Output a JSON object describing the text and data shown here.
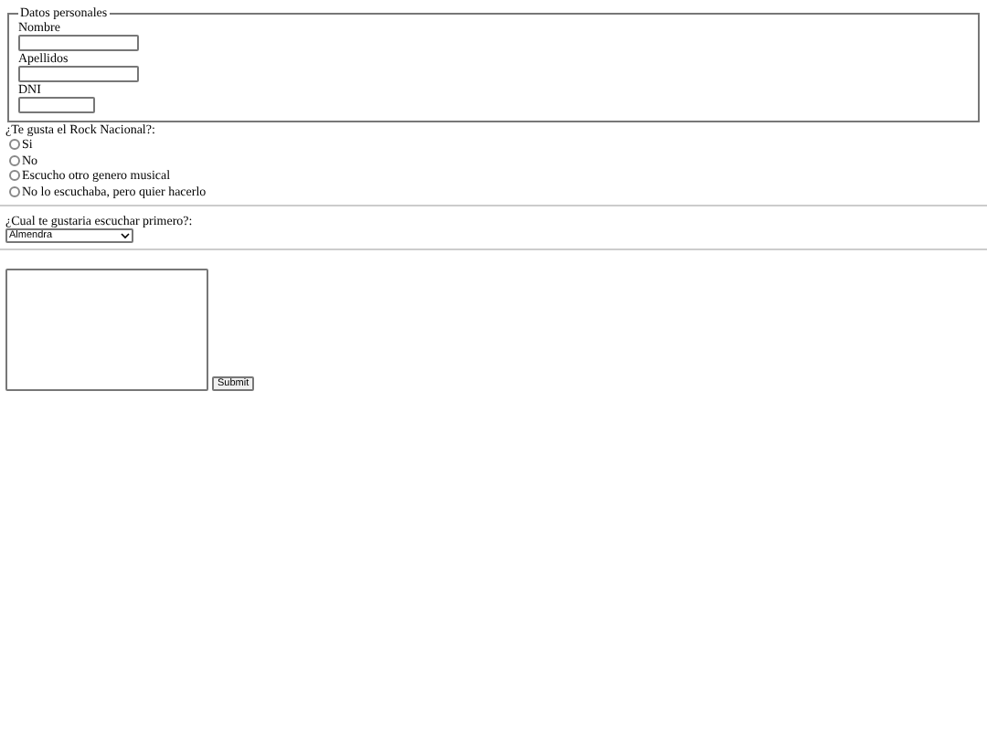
{
  "personal": {
    "legend": "Datos personales",
    "fields": [
      {
        "label": "Nombre"
      },
      {
        "label": "Apellidos"
      },
      {
        "label": "DNI"
      }
    ]
  },
  "question": {
    "label": "¿Te gusta el Rock Nacional?:",
    "options": [
      {
        "label": "Si",
        "selected": false
      },
      {
        "label": "No",
        "selected": false
      },
      {
        "label": "Escucho otro genero musical",
        "selected": false
      },
      {
        "label": "No lo escuchaba, pero quier hacerlo",
        "selected": false
      }
    ]
  },
  "choice": {
    "label": "¿Cual te gustaria escuchar primero?:",
    "value": "Almendra"
  },
  "submit": "Submit"
}
